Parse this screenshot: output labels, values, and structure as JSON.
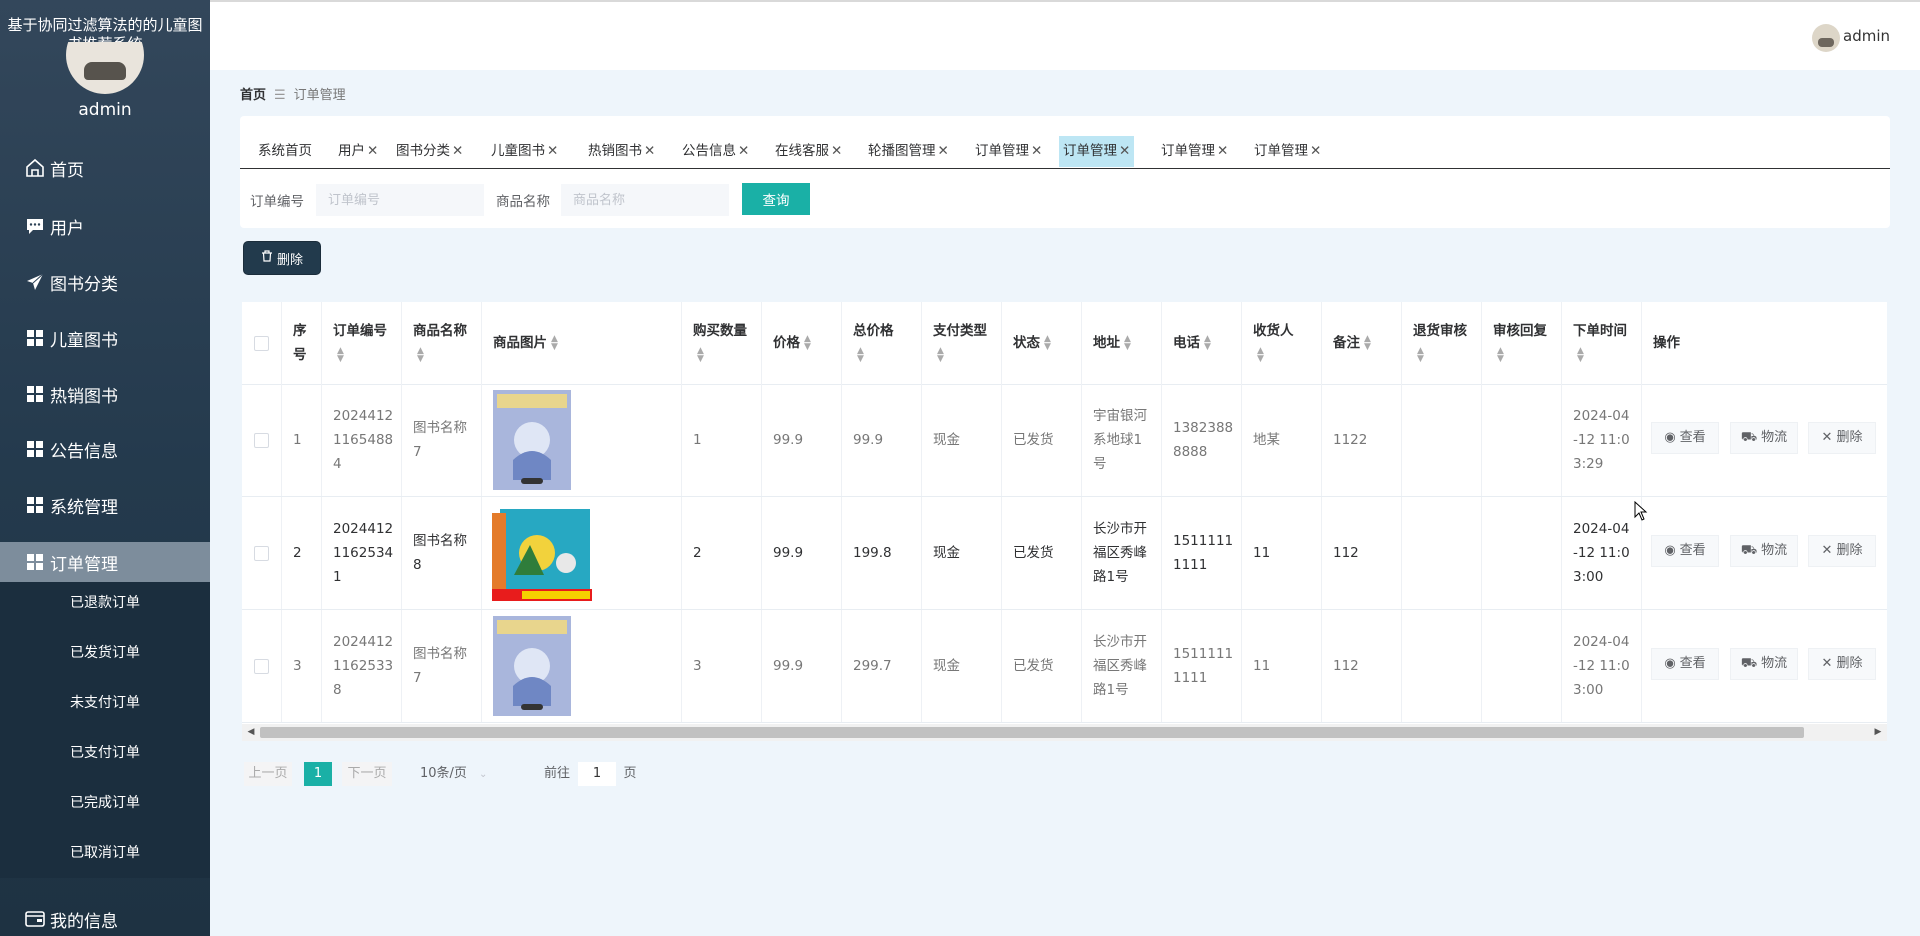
{
  "app": {
    "title": "基于协同过滤算法的的儿童图书推荐系统",
    "username": "admin"
  },
  "topbar": {
    "username": "admin"
  },
  "sidebar": {
    "items": [
      {
        "label": "首页",
        "icon": "home-icon"
      },
      {
        "label": "用户",
        "icon": "chat-icon"
      },
      {
        "label": "图书分类",
        "icon": "send-icon"
      },
      {
        "label": "儿童图书",
        "icon": "grid-icon"
      },
      {
        "label": "热销图书",
        "icon": "grid-icon"
      },
      {
        "label": "公告信息",
        "icon": "grid-icon"
      },
      {
        "label": "系统管理",
        "icon": "grid-icon"
      },
      {
        "label": "订单管理",
        "icon": "grid-icon"
      }
    ],
    "sub_items": [
      "已退款订单",
      "已发货订单",
      "未支付订单",
      "已支付订单",
      "已完成订单",
      "已取消订单"
    ],
    "my_info": "我的信息"
  },
  "breadcrumb": {
    "home": "首页",
    "sep": "☰",
    "current": "订单管理"
  },
  "tabs": [
    {
      "label": "系统首页",
      "closable": false
    },
    {
      "label": "用户",
      "closable": true
    },
    {
      "label": "图书分类",
      "closable": true
    },
    {
      "label": "儿童图书",
      "closable": true
    },
    {
      "label": "热销图书",
      "closable": true
    },
    {
      "label": "公告信息",
      "closable": true
    },
    {
      "label": "在线客服",
      "closable": true
    },
    {
      "label": "轮播图管理",
      "closable": true
    },
    {
      "label": "订单管理",
      "closable": true
    },
    {
      "label": "订单管理",
      "closable": true,
      "active": true
    },
    {
      "label": "订单管理",
      "closable": true
    },
    {
      "label": "订单管理",
      "closable": true
    }
  ],
  "filters": {
    "order_no_label": "订单编号",
    "order_no_placeholder": "订单编号",
    "product_label": "商品名称",
    "product_placeholder": "商品名称",
    "query": "查询"
  },
  "toolbar": {
    "delete": "删除"
  },
  "table": {
    "headers": [
      "序号",
      "订单编号",
      "商品名称",
      "商品图片",
      "购买数量",
      "价格",
      "总价格",
      "支付类型",
      "状态",
      "地址",
      "电话",
      "收货人",
      "备注",
      "退货审核",
      "审核回复",
      "下单时间",
      "操作"
    ],
    "rows": [
      {
        "index": "1",
        "order_no": "2024412 1165488 4",
        "product": "图书名称 7",
        "qty": "1",
        "price": "99.9",
        "total": "99.9",
        "pay": "现金",
        "status": "已发货",
        "address": "宇宙银河 系地球1 号",
        "phone": "1382388 8888",
        "receiver": "地某",
        "note": "1122",
        "return_review": "",
        "review_reply": "",
        "time": "2024-04 -12 11:0 3:29"
      },
      {
        "index": "2",
        "order_no": "2024412 1162534 1",
        "product": "图书名称 8",
        "qty": "2",
        "price": "99.9",
        "total": "199.8",
        "pay": "现金",
        "status": "已发货",
        "address": "长沙市开 福区秀峰 路1号",
        "phone": "1511111 1111",
        "receiver": "11",
        "note": "112",
        "return_review": "",
        "review_reply": "",
        "time": "2024-04 -12 11:0 3:00"
      },
      {
        "index": "3",
        "order_no": "2024412 1162533 8",
        "product": "图书名称 7",
        "qty": "3",
        "price": "99.9",
        "total": "299.7",
        "pay": "现金",
        "status": "已发货",
        "address": "长沙市开 福区秀峰 路1号",
        "phone": "1511111 1111",
        "receiver": "11",
        "note": "112",
        "return_review": "",
        "review_reply": "",
        "time": "2024-04 -12 11:0 3:00"
      }
    ],
    "actions": {
      "view": "查看",
      "logistics": "物流",
      "delete": "删除"
    }
  },
  "pagination": {
    "prev": "上一页",
    "current": "1",
    "next": "下一页",
    "page_size": "10条/页",
    "goto": "前往",
    "goto_value": "1",
    "page_unit": "页"
  },
  "colors": {
    "sidebar": "#2c4256",
    "accent": "#1ab0a6",
    "active_tab": "#bde6f4",
    "background": "#eef5fb"
  }
}
